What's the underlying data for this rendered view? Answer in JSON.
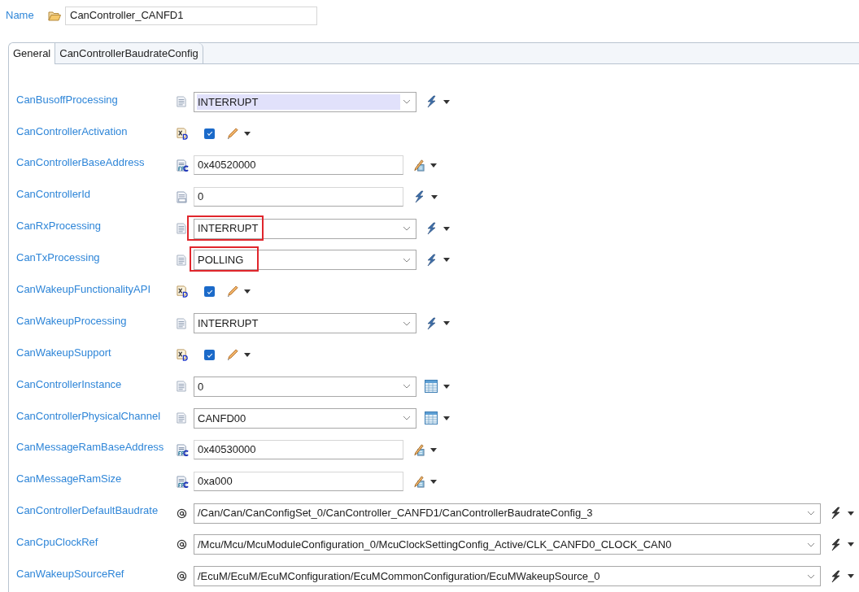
{
  "name_field": {
    "label": "Name",
    "value": "CanController_CANFD1"
  },
  "tabs": [
    {
      "label": "General",
      "selected": true
    },
    {
      "label": "CanControllerBaudrateConfig",
      "selected": false
    }
  ],
  "parameters": [
    {
      "label": "CanBusoffProcessing",
      "kind": "combo",
      "value": "INTERRUPT",
      "text_selected": true,
      "highlighted": false
    },
    {
      "label": "CanControllerActivation",
      "kind": "checkbox",
      "checked": true
    },
    {
      "label": "CanControllerBaseAddress",
      "kind": "address",
      "value": "0x40520000"
    },
    {
      "label": "CanControllerId",
      "kind": "integer",
      "value": "0"
    },
    {
      "label": "CanRxProcessing",
      "kind": "combo",
      "value": "INTERRUPT",
      "text_selected": false,
      "highlighted": true
    },
    {
      "label": "CanTxProcessing",
      "kind": "combo",
      "value": "POLLING",
      "text_selected": false,
      "highlighted": true
    },
    {
      "label": "CanWakeupFunctionalityAPI",
      "kind": "checkbox",
      "checked": true
    },
    {
      "label": "CanWakeupProcessing",
      "kind": "combo",
      "value": "INTERRUPT",
      "text_selected": false,
      "highlighted": false
    },
    {
      "label": "CanWakeupSupport",
      "kind": "checkbox",
      "checked": true
    },
    {
      "label": "CanControllerInstance",
      "kind": "selector",
      "value": "0",
      "text_selected": false,
      "highlighted": false
    },
    {
      "label": "CanControllerPhysicalChannel",
      "kind": "selector",
      "value": "CANFD00",
      "text_selected": false,
      "highlighted": false
    },
    {
      "label": "CanMessageRamBaseAddress",
      "kind": "address",
      "value": "0x40530000"
    },
    {
      "label": "CanMessageRamSize",
      "kind": "address",
      "value": "0xa000"
    },
    {
      "label": "CanControllerDefaultBaudrate",
      "kind": "reference",
      "value": "/Can/Can/CanConfigSet_0/CanController_CANFD1/CanControllerBaudrateConfig_3"
    },
    {
      "label": "CanCpuClockRef",
      "kind": "reference",
      "value": "/Mcu/Mcu/McuModuleConfiguration_0/McuClockSettingConfig_Active/CLK_CANFD0_CLOCK_CAN0"
    },
    {
      "label": "CanWakeupSourceRef",
      "kind": "reference",
      "value": "/EcuM/EcuM/EcuMConfiguration/EcuMCommonConfiguration/EcuMWakeupSource_0"
    }
  ]
}
